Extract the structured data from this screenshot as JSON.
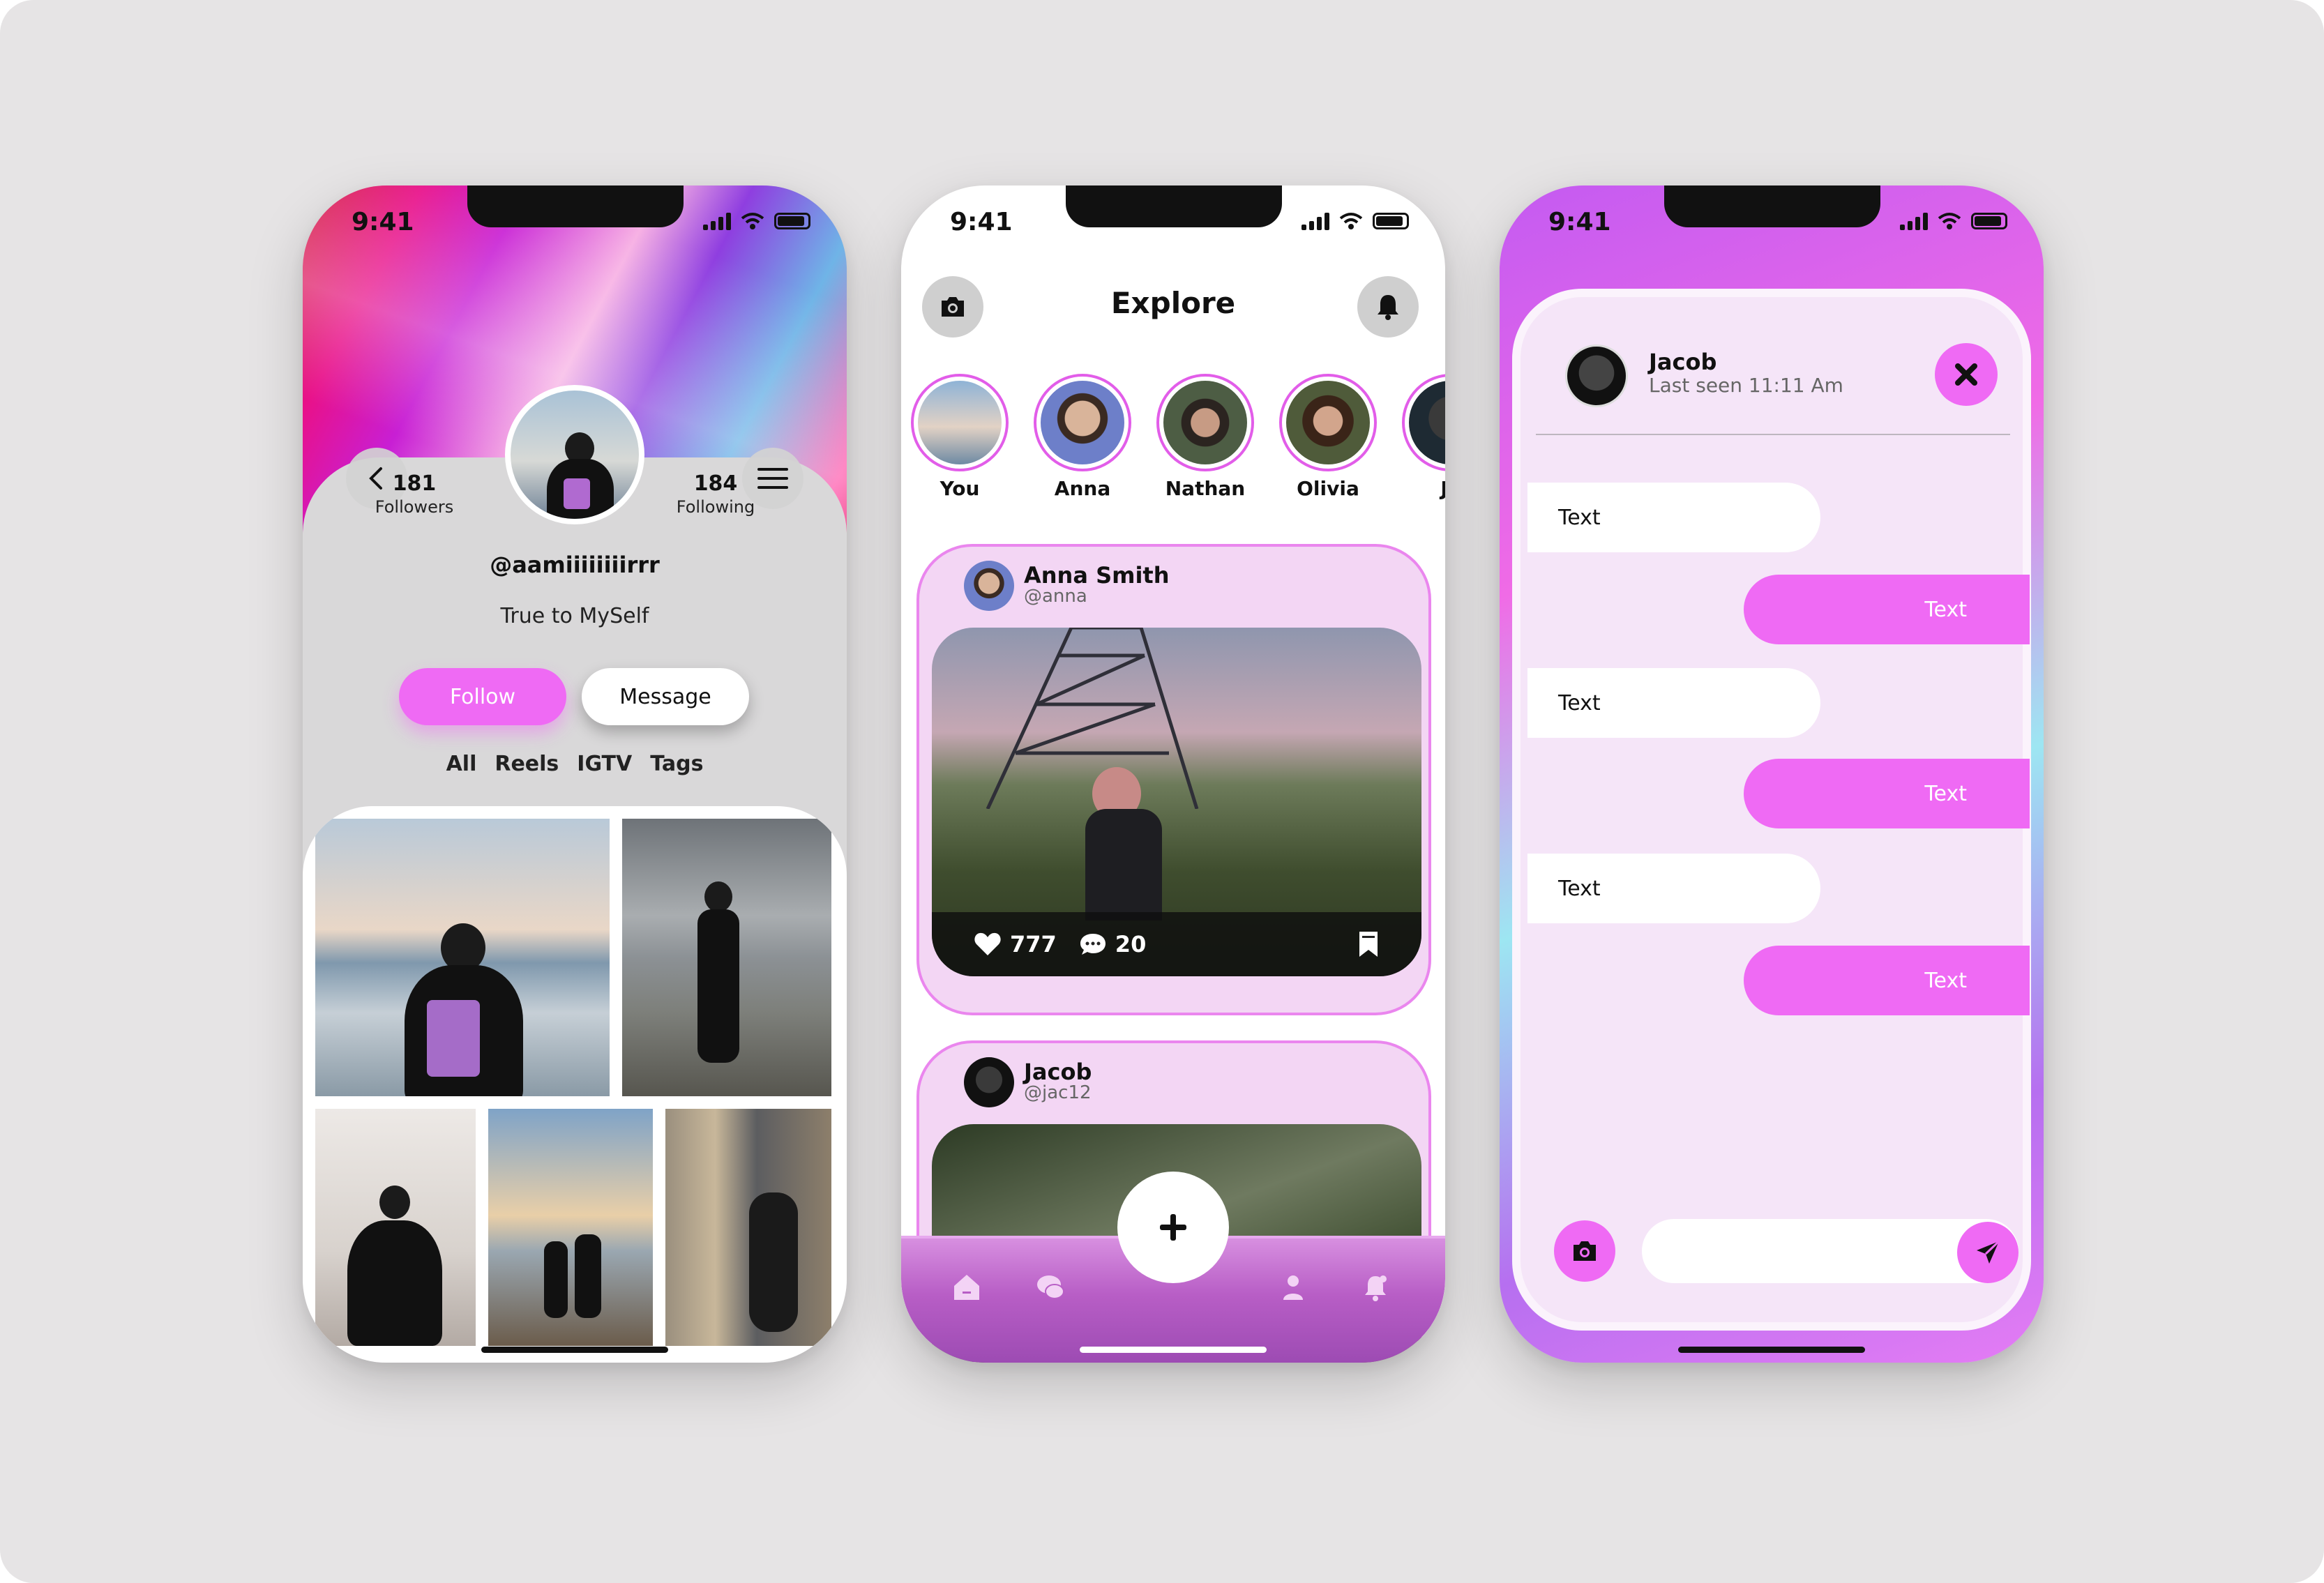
{
  "status_time": "9:41",
  "profile": {
    "followers_count": "181",
    "followers_label": "Followers",
    "following_count": "184",
    "following_label": "Following",
    "username": "@aamiiiiiiiirrr",
    "bio": "True to MySelf",
    "follow_label": "Follow",
    "message_label": "Message",
    "tabs": [
      "All",
      "Reels",
      "IGTV",
      "Tags"
    ]
  },
  "explore": {
    "title": "Explore",
    "stories": [
      "You",
      "Anna",
      "Nathan",
      "Olivia",
      "Ja"
    ],
    "posts": [
      {
        "name": "Anna Smith",
        "handle": "@anna",
        "likes": "777",
        "comments": "20"
      },
      {
        "name": "Jacob",
        "handle": "@jac12"
      }
    ]
  },
  "chat": {
    "name": "Jacob",
    "last_seen": "Last seen 11:11 Am",
    "messages": [
      {
        "dir": "in",
        "text": "Text"
      },
      {
        "dir": "out",
        "text": "Text"
      },
      {
        "dir": "in",
        "text": "Text"
      },
      {
        "dir": "out",
        "text": "Text"
      },
      {
        "dir": "in",
        "text": "Text"
      },
      {
        "dir": "out",
        "text": "Text"
      }
    ],
    "input_placeholder": ""
  },
  "colors": {
    "accent": "#ef6af4",
    "ring": "#e25de9",
    "post_bg": "#f3d6f4",
    "chat_bg": "#f5e5f8"
  },
  "icons": [
    "back-arrow-icon",
    "menu-icon",
    "camera-icon",
    "bell-icon",
    "heart-icon",
    "comment-icon",
    "bookmark-icon",
    "home-icon",
    "chat-icon",
    "plus-icon",
    "profile-icon",
    "notification-icon",
    "close-icon",
    "send-icon"
  ]
}
